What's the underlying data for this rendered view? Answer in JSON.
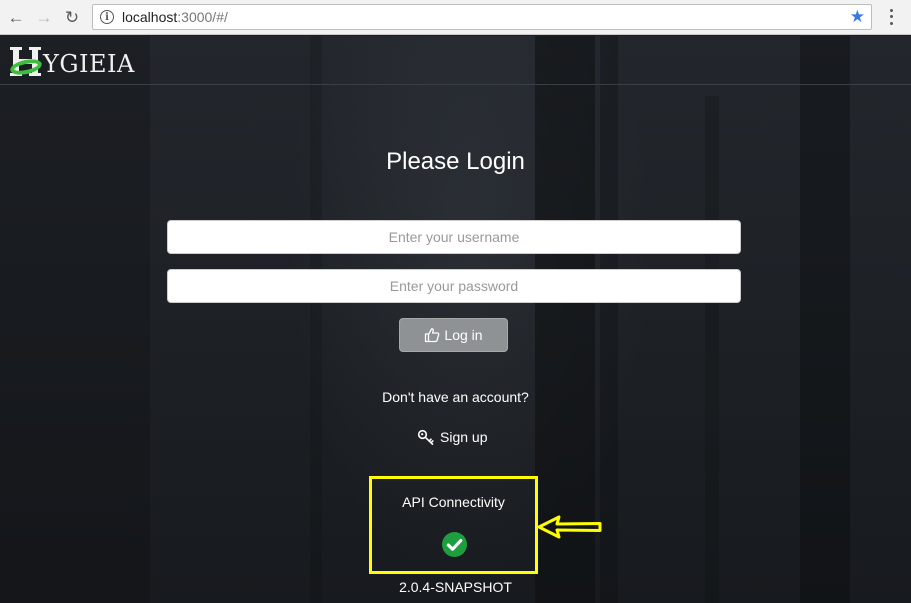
{
  "browser": {
    "url_host": "localhost",
    "url_rest": ":3000/#/"
  },
  "header": {
    "logo_text": "YGIEIA"
  },
  "login": {
    "title": "Please Login",
    "username_placeholder": "Enter your username",
    "password_placeholder": "Enter your password",
    "login_label": "Log in",
    "no_account_text": "Don't have an account?",
    "signup_label": "Sign up"
  },
  "status": {
    "api_label": "API Connectivity",
    "connected": true,
    "version": "2.0.4-SNAPSHOT"
  },
  "icons": {
    "back": "arrow-left-icon",
    "forward": "arrow-right-icon",
    "reload": "reload-icon",
    "info": "info-icon",
    "bookmark": "star-icon",
    "menu": "kebab-menu-icon",
    "login": "thumbs-up-icon",
    "signup": "key-icon",
    "status": "check-circle-icon",
    "annotation": "arrow-left-outline-icon"
  },
  "colors": {
    "check_green": "#1e9e3e",
    "highlight_yellow": "#ffff00",
    "logo_green": "#3ebd3e",
    "star_blue": "#3b78e7"
  }
}
